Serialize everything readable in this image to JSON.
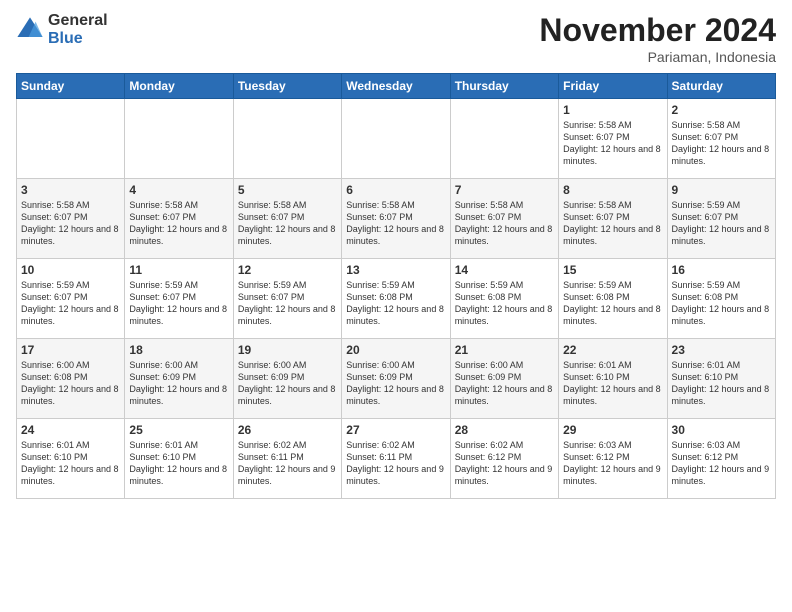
{
  "logo": {
    "general": "General",
    "blue": "Blue"
  },
  "title": "November 2024",
  "location": "Pariaman, Indonesia",
  "days_of_week": [
    "Sunday",
    "Monday",
    "Tuesday",
    "Wednesday",
    "Thursday",
    "Friday",
    "Saturday"
  ],
  "weeks": [
    [
      {
        "day": "",
        "text": ""
      },
      {
        "day": "",
        "text": ""
      },
      {
        "day": "",
        "text": ""
      },
      {
        "day": "",
        "text": ""
      },
      {
        "day": "",
        "text": ""
      },
      {
        "day": "1",
        "text": "Sunrise: 5:58 AM\nSunset: 6:07 PM\nDaylight: 12 hours and 8 minutes."
      },
      {
        "day": "2",
        "text": "Sunrise: 5:58 AM\nSunset: 6:07 PM\nDaylight: 12 hours and 8 minutes."
      }
    ],
    [
      {
        "day": "3",
        "text": "Sunrise: 5:58 AM\nSunset: 6:07 PM\nDaylight: 12 hours and 8 minutes."
      },
      {
        "day": "4",
        "text": "Sunrise: 5:58 AM\nSunset: 6:07 PM\nDaylight: 12 hours and 8 minutes."
      },
      {
        "day": "5",
        "text": "Sunrise: 5:58 AM\nSunset: 6:07 PM\nDaylight: 12 hours and 8 minutes."
      },
      {
        "day": "6",
        "text": "Sunrise: 5:58 AM\nSunset: 6:07 PM\nDaylight: 12 hours and 8 minutes."
      },
      {
        "day": "7",
        "text": "Sunrise: 5:58 AM\nSunset: 6:07 PM\nDaylight: 12 hours and 8 minutes."
      },
      {
        "day": "8",
        "text": "Sunrise: 5:58 AM\nSunset: 6:07 PM\nDaylight: 12 hours and 8 minutes."
      },
      {
        "day": "9",
        "text": "Sunrise: 5:59 AM\nSunset: 6:07 PM\nDaylight: 12 hours and 8 minutes."
      }
    ],
    [
      {
        "day": "10",
        "text": "Sunrise: 5:59 AM\nSunset: 6:07 PM\nDaylight: 12 hours and 8 minutes."
      },
      {
        "day": "11",
        "text": "Sunrise: 5:59 AM\nSunset: 6:07 PM\nDaylight: 12 hours and 8 minutes."
      },
      {
        "day": "12",
        "text": "Sunrise: 5:59 AM\nSunset: 6:07 PM\nDaylight: 12 hours and 8 minutes."
      },
      {
        "day": "13",
        "text": "Sunrise: 5:59 AM\nSunset: 6:08 PM\nDaylight: 12 hours and 8 minutes."
      },
      {
        "day": "14",
        "text": "Sunrise: 5:59 AM\nSunset: 6:08 PM\nDaylight: 12 hours and 8 minutes."
      },
      {
        "day": "15",
        "text": "Sunrise: 5:59 AM\nSunset: 6:08 PM\nDaylight: 12 hours and 8 minutes."
      },
      {
        "day": "16",
        "text": "Sunrise: 5:59 AM\nSunset: 6:08 PM\nDaylight: 12 hours and 8 minutes."
      }
    ],
    [
      {
        "day": "17",
        "text": "Sunrise: 6:00 AM\nSunset: 6:08 PM\nDaylight: 12 hours and 8 minutes."
      },
      {
        "day": "18",
        "text": "Sunrise: 6:00 AM\nSunset: 6:09 PM\nDaylight: 12 hours and 8 minutes."
      },
      {
        "day": "19",
        "text": "Sunrise: 6:00 AM\nSunset: 6:09 PM\nDaylight: 12 hours and 8 minutes."
      },
      {
        "day": "20",
        "text": "Sunrise: 6:00 AM\nSunset: 6:09 PM\nDaylight: 12 hours and 8 minutes."
      },
      {
        "day": "21",
        "text": "Sunrise: 6:00 AM\nSunset: 6:09 PM\nDaylight: 12 hours and 8 minutes."
      },
      {
        "day": "22",
        "text": "Sunrise: 6:01 AM\nSunset: 6:10 PM\nDaylight: 12 hours and 8 minutes."
      },
      {
        "day": "23",
        "text": "Sunrise: 6:01 AM\nSunset: 6:10 PM\nDaylight: 12 hours and 8 minutes."
      }
    ],
    [
      {
        "day": "24",
        "text": "Sunrise: 6:01 AM\nSunset: 6:10 PM\nDaylight: 12 hours and 8 minutes."
      },
      {
        "day": "25",
        "text": "Sunrise: 6:01 AM\nSunset: 6:10 PM\nDaylight: 12 hours and 8 minutes."
      },
      {
        "day": "26",
        "text": "Sunrise: 6:02 AM\nSunset: 6:11 PM\nDaylight: 12 hours and 9 minutes."
      },
      {
        "day": "27",
        "text": "Sunrise: 6:02 AM\nSunset: 6:11 PM\nDaylight: 12 hours and 9 minutes."
      },
      {
        "day": "28",
        "text": "Sunrise: 6:02 AM\nSunset: 6:12 PM\nDaylight: 12 hours and 9 minutes."
      },
      {
        "day": "29",
        "text": "Sunrise: 6:03 AM\nSunset: 6:12 PM\nDaylight: 12 hours and 9 minutes."
      },
      {
        "day": "30",
        "text": "Sunrise: 6:03 AM\nSunset: 6:12 PM\nDaylight: 12 hours and 9 minutes."
      }
    ]
  ]
}
